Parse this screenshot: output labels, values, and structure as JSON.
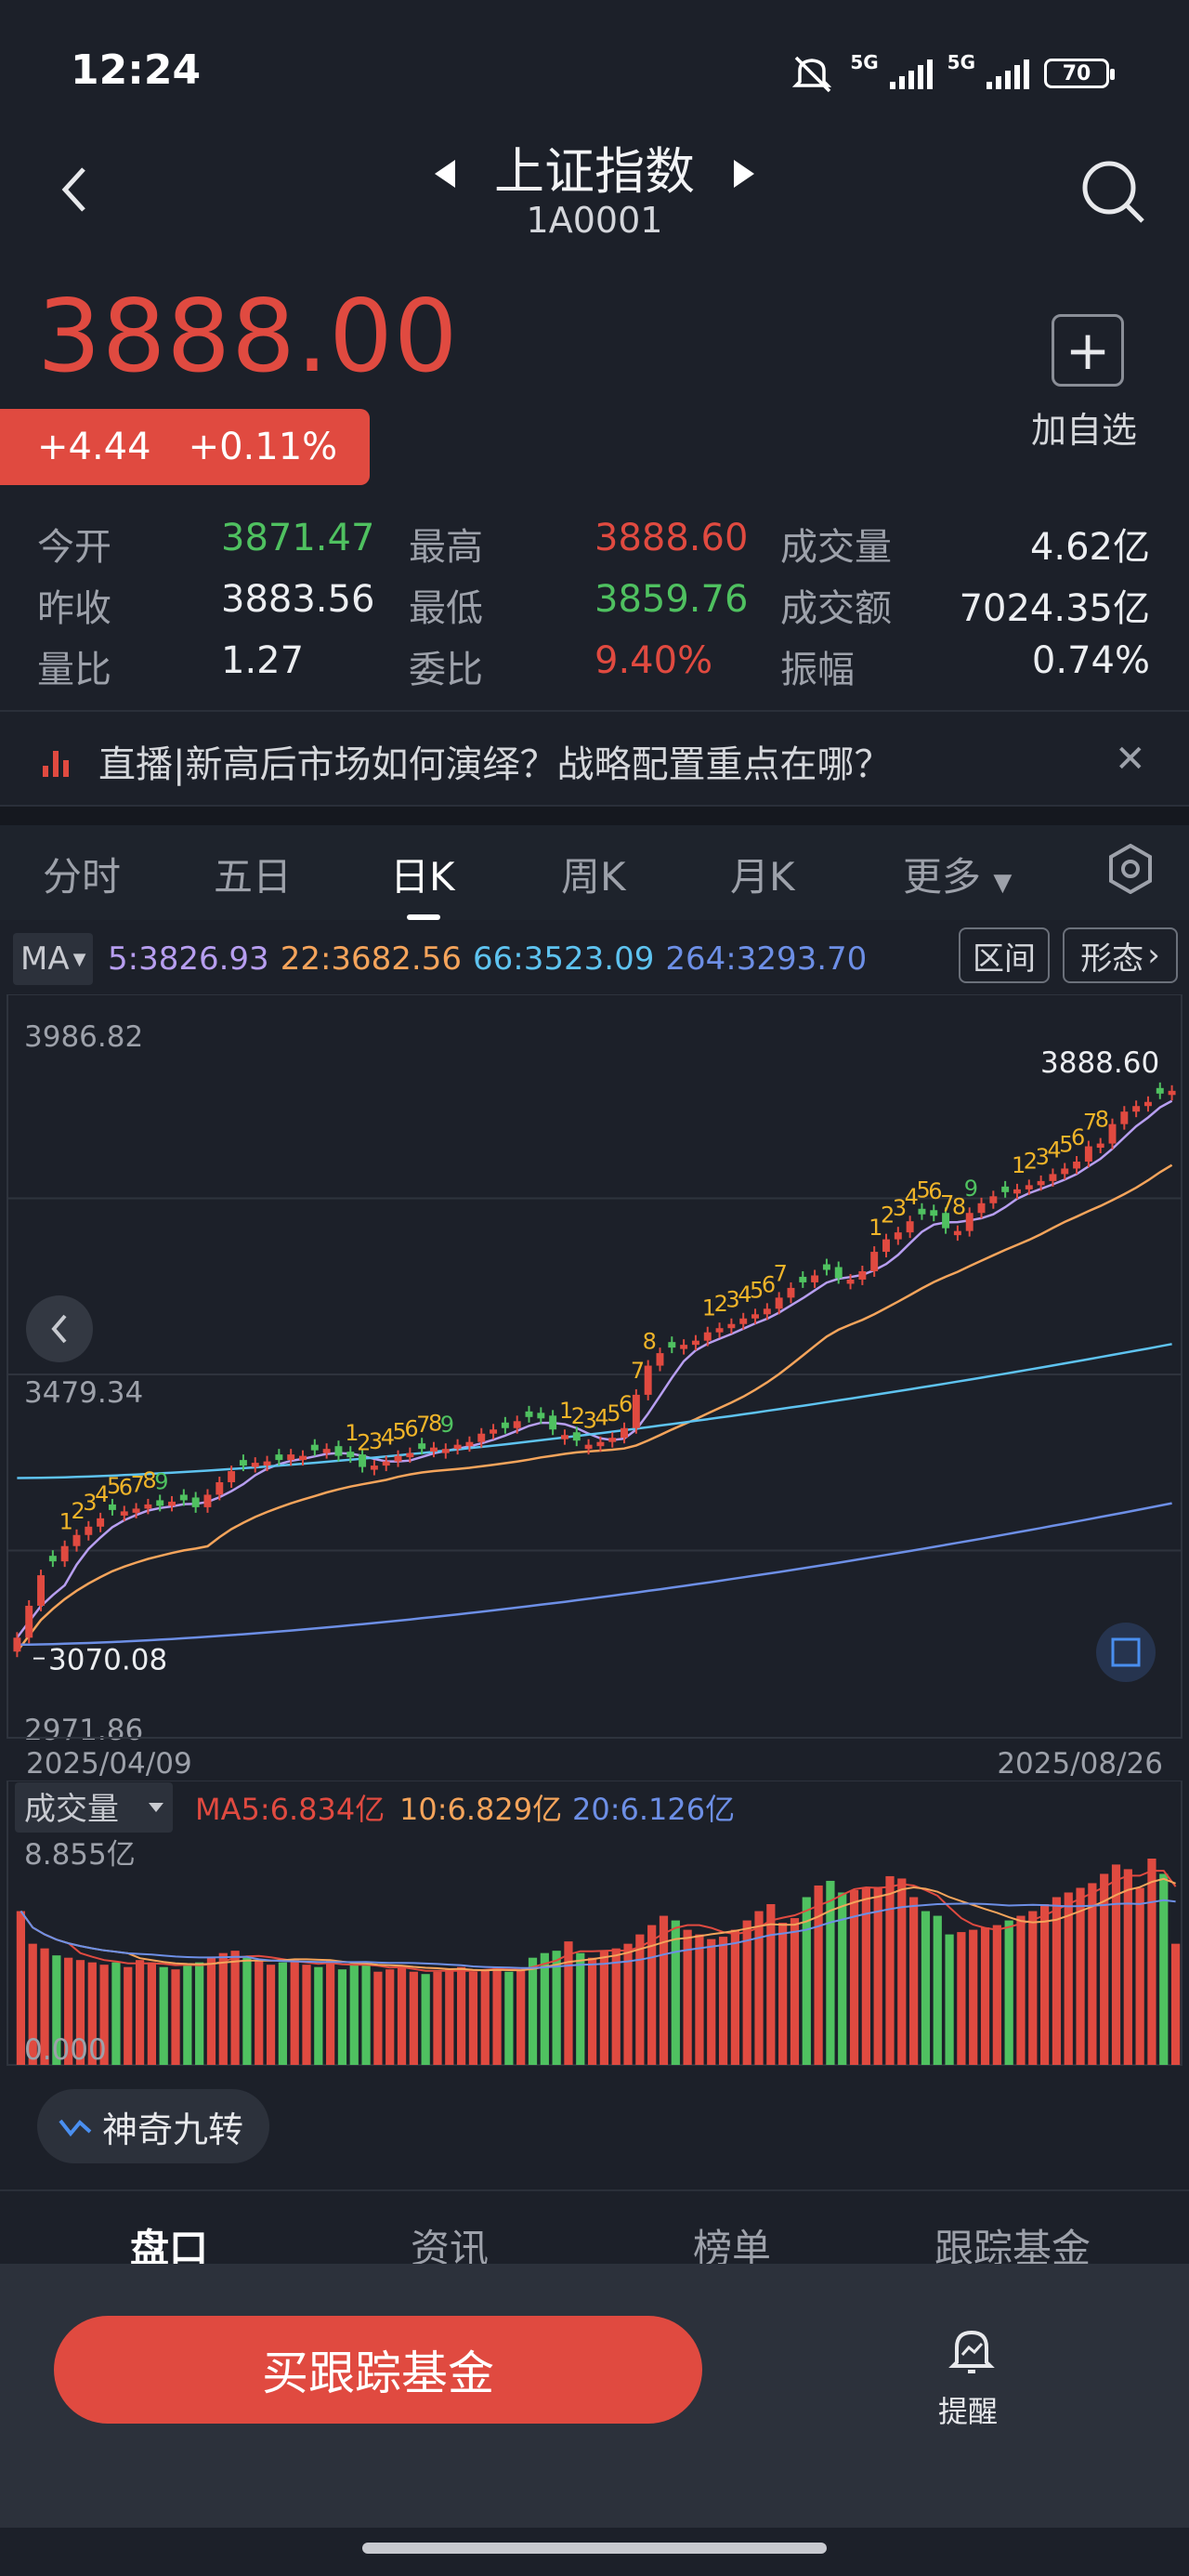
{
  "status_bar": {
    "time": "12:24",
    "network1": "5G",
    "network2": "5G",
    "battery": "70"
  },
  "header": {
    "title": "上证指数",
    "code": "1A0001"
  },
  "quote": {
    "price": "3888.00",
    "change": "+4.44",
    "change_pct": "+0.11%",
    "add_label": "加自选"
  },
  "stats": [
    {
      "label": "今开",
      "value": "3871.47",
      "color": "green"
    },
    {
      "label": "最高",
      "value": "3888.60",
      "color": "red"
    },
    {
      "label": "成交量",
      "value": "4.62亿",
      "color": "white"
    },
    {
      "label": "昨收",
      "value": "3883.56",
      "color": "white"
    },
    {
      "label": "最低",
      "value": "3859.76",
      "color": "green"
    },
    {
      "label": "成交额",
      "value": "7024.35亿",
      "color": "white"
    },
    {
      "label": "量比",
      "value": "1.27",
      "color": "white"
    },
    {
      "label": "委比",
      "value": "9.40%",
      "color": "red"
    },
    {
      "label": "振幅",
      "value": "0.74%",
      "color": "white"
    }
  ],
  "news": {
    "text": "直播|新高后市场如何演绎？战略配置重点在哪？"
  },
  "tabs": [
    "分时",
    "五日",
    "日K",
    "周K",
    "月K",
    "更多"
  ],
  "active_tab": "日K",
  "ma_bar": {
    "label": "MA",
    "ma5": "5:3826.93",
    "ma22": "22:3682.56",
    "ma66": "66:3523.09",
    "ma264": "264:3293.70",
    "btn_range": "区间",
    "btn_pattern": "形态"
  },
  "colors": {
    "up": "#e04a40",
    "down": "#4fc160",
    "ma5": "#b79ef0",
    "ma22": "#f5a45b",
    "ma66": "#5ec3f0",
    "ma264": "#6d8fe6",
    "nine": "#f0b429"
  },
  "chart_data": [
    {
      "type": "candlestick",
      "title": "",
      "y_labels": [
        "3986.82",
        "3479.34",
        "2971.86"
      ],
      "ylim": [
        2971.86,
        3986.82
      ],
      "x_start_label": "2025/04/09",
      "x_end_label": "2025/08/26",
      "max_label": "3888.60",
      "min_label": "3070.08",
      "closes": [
        3100,
        3146,
        3190,
        3210,
        3232,
        3248,
        3260,
        3272,
        3284,
        3282,
        3286,
        3292,
        3290,
        3296,
        3298,
        3288,
        3306,
        3324,
        3340,
        3348,
        3352,
        3354,
        3356,
        3364,
        3362,
        3370,
        3372,
        3362,
        3360,
        3346,
        3348,
        3354,
        3362,
        3366,
        3372,
        3374,
        3372,
        3378,
        3382,
        3394,
        3400,
        3402,
        3412,
        3418,
        3416,
        3400,
        3392,
        3384,
        3378,
        3382,
        3388,
        3402,
        3450,
        3492,
        3510,
        3518,
        3522,
        3528,
        3540,
        3546,
        3552,
        3560,
        3566,
        3574,
        3590,
        3604,
        3612,
        3622,
        3630,
        3618,
        3616,
        3628,
        3656,
        3674,
        3684,
        3700,
        3710,
        3708,
        3690,
        3686,
        3712,
        3726,
        3736,
        3742,
        3746,
        3752,
        3758,
        3768,
        3776,
        3786,
        3808,
        3812,
        3840,
        3858,
        3866,
        3872,
        3884,
        3888
      ],
      "up_down": [
        "up",
        "up",
        "up",
        "down",
        "up",
        "up",
        "up",
        "up",
        "down",
        "up",
        "up",
        "up",
        "down",
        "up",
        "down",
        "down",
        "up",
        "up",
        "up",
        "down",
        "up",
        "up",
        "down",
        "up",
        "up",
        "down",
        "up",
        "down",
        "down",
        "down",
        "up",
        "up",
        "up",
        "up",
        "down",
        "up",
        "up",
        "up",
        "up",
        "up",
        "up",
        "down",
        "up",
        "down",
        "down",
        "down",
        "up",
        "down",
        "up",
        "up",
        "up",
        "up",
        "up",
        "up",
        "up",
        "down",
        "up",
        "up",
        "up",
        "up",
        "up",
        "up",
        "up",
        "up",
        "up",
        "up",
        "down",
        "up",
        "down",
        "down",
        "up",
        "up",
        "up",
        "up",
        "up",
        "up",
        "down",
        "down",
        "down",
        "up",
        "up",
        "up",
        "up",
        "down",
        "up",
        "up",
        "up",
        "up",
        "up",
        "up",
        "up",
        "up",
        "up",
        "up",
        "up",
        "up",
        "down",
        "up"
      ],
      "ma_series": [
        {
          "name": "5",
          "values_start": 3150,
          "values_end": 3826.93
        },
        {
          "name": "22",
          "values_start": 3180,
          "values_end": 3682.56
        },
        {
          "name": "66",
          "values_start": 3330,
          "values_end": 3523.09
        },
        {
          "name": "264",
          "values_start": 3090,
          "values_end": 3293.7
        }
      ]
    },
    {
      "type": "bar",
      "title": "成交量",
      "ma_labels": {
        "ma5": "MA5:6.834亿",
        "ma10": "10:6.829亿",
        "ma20": "20:6.126亿"
      },
      "y_labels": [
        "8.855亿",
        "0.000"
      ],
      "ylim": [
        0,
        8.855
      ],
      "values": [
        6.6,
        5.2,
        5.0,
        4.7,
        4.6,
        4.5,
        4.4,
        4.3,
        4.4,
        4.2,
        4.5,
        4.4,
        4.2,
        4.1,
        4.3,
        4.4,
        4.6,
        4.8,
        4.9,
        4.6,
        4.5,
        4.3,
        4.4,
        4.5,
        4.3,
        4.2,
        4.5,
        4.1,
        4.4,
        4.3,
        4.0,
        4.1,
        4.2,
        4.0,
        3.9,
        4.0,
        4.1,
        4.2,
        4.0,
        4.1,
        4.2,
        4.0,
        4.1,
        4.6,
        4.8,
        4.9,
        5.3,
        4.8,
        4.6,
        4.9,
        5.0,
        5.2,
        5.6,
        6.0,
        6.4,
        6.2,
        5.8,
        5.6,
        5.4,
        5.5,
        5.8,
        6.2,
        6.6,
        6.9,
        6.1,
        6.3,
        7.2,
        7.7,
        7.9,
        7.4,
        7.5,
        7.6,
        7.6,
        8.1,
        8.0,
        7.2,
        6.6,
        6.4,
        5.6,
        5.7,
        5.8,
        5.9,
        6.0,
        6.2,
        6.4,
        6.6,
        6.9,
        7.2,
        7.4,
        7.6,
        7.8,
        8.2,
        8.6,
        8.4,
        7.6,
        8.855,
        8.2,
        5.2
      ],
      "up_down": [
        "up",
        "up",
        "up",
        "down",
        "up",
        "up",
        "up",
        "up",
        "down",
        "up",
        "up",
        "up",
        "down",
        "up",
        "down",
        "down",
        "up",
        "up",
        "up",
        "down",
        "up",
        "up",
        "down",
        "up",
        "up",
        "down",
        "up",
        "down",
        "down",
        "down",
        "up",
        "up",
        "up",
        "up",
        "down",
        "up",
        "up",
        "up",
        "up",
        "up",
        "up",
        "down",
        "up",
        "down",
        "down",
        "down",
        "up",
        "down",
        "up",
        "up",
        "up",
        "up",
        "up",
        "up",
        "up",
        "down",
        "up",
        "up",
        "up",
        "up",
        "up",
        "up",
        "up",
        "up",
        "up",
        "up",
        "down",
        "up",
        "down",
        "down",
        "up",
        "up",
        "up",
        "up",
        "up",
        "up",
        "down",
        "down",
        "down",
        "up",
        "up",
        "up",
        "up",
        "down",
        "up",
        "up",
        "up",
        "up",
        "up",
        "up",
        "up",
        "up",
        "up",
        "up",
        "up",
        "up",
        "down",
        "up"
      ]
    }
  ],
  "indicator_toggle": "神奇九转",
  "bottom_tabs": [
    "盘口",
    "资讯",
    "榜单",
    "跟踪基金"
  ],
  "footer": {
    "buy_label": "买跟踪基金",
    "remind_label": "提醒"
  }
}
